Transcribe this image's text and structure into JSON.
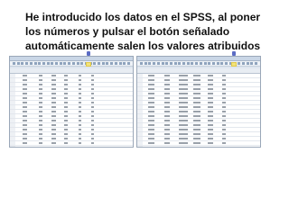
{
  "caption": {
    "line1": "He introducido los datos en el SPSS, al poner",
    "line2": "los números y pulsar el botón señalado",
    "line3": "automáticamente salen los valores atribuidos"
  },
  "colors": {
    "accent_marker": "#5b6cc4",
    "highlight": "#f1e37a",
    "window_border": "#9aa7b8"
  },
  "icons": [
    "arrow-marker-icon",
    "toolbar-icon"
  ]
}
